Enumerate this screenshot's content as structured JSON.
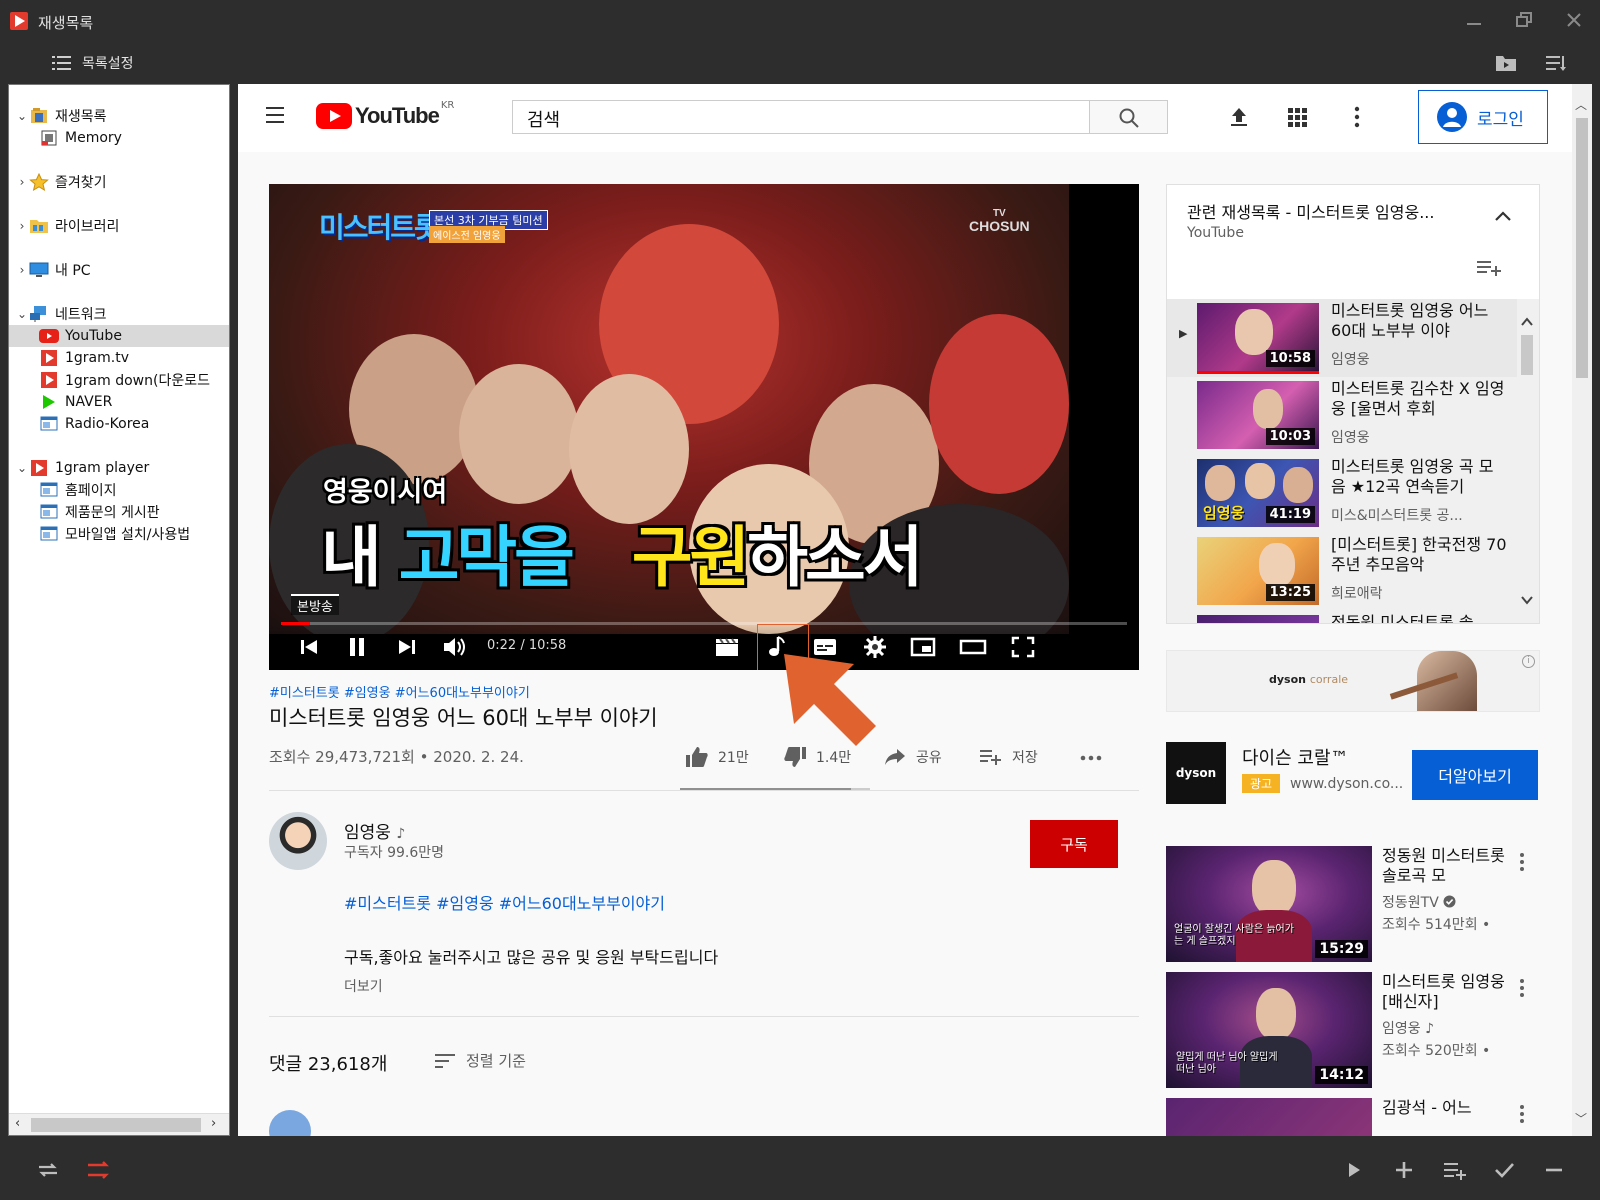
{
  "window": {
    "title": "재생목록",
    "menu_list_settings": "목록설정"
  },
  "tree": {
    "items": [
      {
        "label": "재생목록",
        "icon": "playlist-folder-icon",
        "level": 0,
        "expander": "open"
      },
      {
        "label": "Memory",
        "icon": "memory-icon",
        "level": 1,
        "expander": "none"
      },
      {
        "label": "즐겨찾기",
        "icon": "star-icon",
        "level": 0,
        "expander": "closed"
      },
      {
        "label": "라이브러리",
        "icon": "library-folder-icon",
        "level": 0,
        "expander": "closed"
      },
      {
        "label": "내 PC",
        "icon": "pc-icon",
        "level": 0,
        "expander": "closed"
      },
      {
        "label": "네트워크",
        "icon": "network-icon",
        "level": 0,
        "expander": "open"
      },
      {
        "label": "YouTube",
        "icon": "youtube-icon",
        "level": 1,
        "expander": "none",
        "selected": true
      },
      {
        "label": "1gram.tv",
        "icon": "1gram-icon",
        "level": 1,
        "expander": "none"
      },
      {
        "label": "1gram down(다운로드",
        "icon": "1gram-icon",
        "level": 1,
        "expander": "none"
      },
      {
        "label": "NAVER",
        "icon": "naver-icon",
        "level": 1,
        "expander": "none"
      },
      {
        "label": "Radio-Korea",
        "icon": "web-page-icon",
        "level": 1,
        "expander": "none"
      },
      {
        "label": "1gram player",
        "icon": "1gram-icon",
        "level": 0,
        "expander": "open"
      },
      {
        "label": "홈페이지",
        "icon": "web-page-icon",
        "level": 1,
        "expander": "none"
      },
      {
        "label": "제품문의 게시판",
        "icon": "web-page-icon",
        "level": 1,
        "expander": "none"
      },
      {
        "label": "모바일앱 설치/사용법",
        "icon": "web-page-icon",
        "level": 1,
        "expander": "none"
      }
    ]
  },
  "youtube": {
    "logo_text": "YouTube",
    "region": "KR",
    "search_placeholder": "검색",
    "login_label": "로그인",
    "player": {
      "time": "0:22 / 10:58",
      "progress_fraction": 0.034,
      "show_logo": "미스터트롯",
      "show_tag": "본선 3차 기부금 팀미션",
      "show_tag2": "에이스전 임영웅",
      "channel_badge_top": "TV",
      "channel_badge": "CHOSUN",
      "subtitle_small": "영웅이시여",
      "subtitle_big_1": "내 ",
      "subtitle_big_2": "고막을",
      "subtitle_big_3": "구원",
      "subtitle_big_4": "하소서",
      "live_tag": "본방송"
    },
    "video": {
      "hashtags": "#미스터트롯 #임영웅 #어느60대노부부이야기",
      "title": "미스터트롯 임영웅 어느 60대 노부부 이야기",
      "views": "조회수 29,473,721회 • 2020. 2. 24.",
      "likes": "21만",
      "dislikes": "1.4만",
      "share": "공유",
      "save": "저장",
      "like_ratio": 0.9
    },
    "channel": {
      "name": "임영웅",
      "note": "♪",
      "subscribers": "구독자 99.6만명",
      "subscribe_label": "구독"
    },
    "description": {
      "tags": "#미스터트롯 #임영웅 #어느60대노부부이야기",
      "text": "구독,좋아요 눌러주시고 많은 공유 및 응원 부탁드립니다",
      "more": "더보기"
    },
    "comments": {
      "count": "댓글 23,618개",
      "sort": "정렬 기준"
    },
    "playlist": {
      "title": "관련 재생목록 - 미스터트롯 임영웅...",
      "subtitle": "YouTube",
      "now_playing_marker": "▶",
      "items": [
        {
          "title": "미스터트롯 임영웅 어느 60대 노부부 이야",
          "channel": "임영웅",
          "duration": "10:58"
        },
        {
          "title": "미스터트롯 김수찬 X 임영웅 [울면서 후회",
          "channel": "임영웅",
          "duration": "10:03"
        },
        {
          "title": "미스터트롯 임영웅 곡 모음 ★12곡 연속듣기",
          "channel": "미스&미스터트롯 공...",
          "duration": "41:19",
          "thumb_caption": "임영웅"
        },
        {
          "title": "[미스터트롯] 한국전쟁 70주년 추모음악",
          "channel": "희로애락",
          "duration": "13:25"
        },
        {
          "title": "정동원 미스터트롯 솔",
          "channel": "",
          "duration": ""
        }
      ]
    },
    "ad_banner": {
      "brand": "dyson",
      "product": "corrale",
      "info": "i"
    },
    "ad_card": {
      "logo": "dyson",
      "name": "다이슨 코랄™",
      "badge": "광고",
      "url": "www.dyson.co...",
      "cta": "더알아보기"
    },
    "recommendations": [
      {
        "title": "정동원 미스터트롯 솔로곡 모",
        "channel": "정동원TV",
        "verified": true,
        "meta": "조회수 514만회 •",
        "duration": "15:29",
        "caption": "얼굴이 잘생긴 사람은 늙어가는 게 슬프겠지"
      },
      {
        "title": "미스터트롯 임영웅 [배신자]",
        "channel": "임영웅 ♪",
        "verified": false,
        "meta": "조회수 520만회 •",
        "duration": "14:12",
        "caption": "얄밉게 떠난 님아 얄밉게 떠난 님아"
      },
      {
        "title": "김광석 - 어느",
        "channel": "",
        "verified": false,
        "meta": "",
        "duration": ""
      }
    ]
  },
  "colors": {
    "accent_red": "#ff0000",
    "link_blue": "#065fd4",
    "highlight_orange": "#e0622f",
    "app_dark": "#2d2d2d"
  }
}
